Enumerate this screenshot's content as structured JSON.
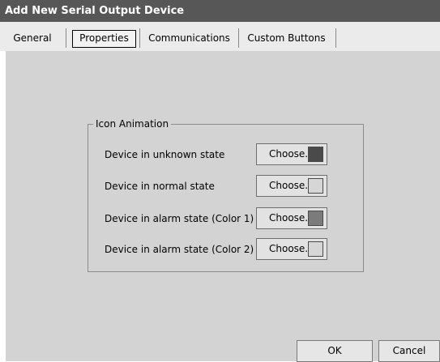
{
  "window": {
    "title": "Add New Serial Output Device"
  },
  "tabs": [
    {
      "label": "General",
      "active": false
    },
    {
      "label": "Properties",
      "active": true
    },
    {
      "label": "Communications",
      "active": false
    },
    {
      "label": "Custom Buttons",
      "active": false
    }
  ],
  "icon_animation": {
    "group_label": "Icon Animation",
    "rows": [
      {
        "label": "Device in unknown state",
        "button_label": "Choose...",
        "swatch_color": "#4a4a4a"
      },
      {
        "label": "Device in normal state",
        "button_label": "Choose...",
        "swatch_color": "#d6d6d6"
      },
      {
        "label": "Device in alarm state (Color 1)",
        "button_label": "Choose...",
        "swatch_color": "#7b7b7b"
      },
      {
        "label": "Device in alarm state (Color 2)",
        "button_label": "Choose...",
        "swatch_color": "#d6d6d6"
      }
    ]
  },
  "footer": {
    "ok_label": "OK",
    "cancel_label": "Cancel"
  }
}
